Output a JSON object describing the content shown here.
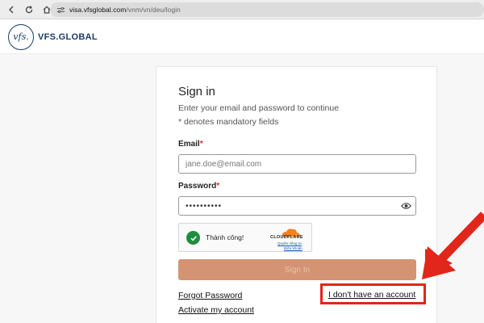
{
  "browser": {
    "url_host": "visa.vfsglobal.com",
    "url_path": "/vnm/vn/deu/login"
  },
  "site": {
    "logo_mark": "vfs.",
    "logo_text": "VFS.GLOBAL"
  },
  "login": {
    "title": "Sign in",
    "subtitle": "Enter your email and password to continue",
    "mandatory_note": "* denotes mandatory fields",
    "email_label": "Email",
    "email_placeholder": "jane.doe@email.com",
    "password_label": "Password",
    "password_value": "••••••••••",
    "required_mark": "*",
    "signin_label": "Sign In",
    "forgot_label": "Forgot Password",
    "activate_label": "Activate my account",
    "no_account_label": "I don't have an account"
  },
  "captcha": {
    "status": "Thành công!",
    "brand": "CLOUDFLARE",
    "privacy": "Quyền riêng tư",
    "terms": "Điều khoản"
  },
  "colors": {
    "brand_navy": "#1c3a63",
    "signin_button": "#d49373",
    "annotation_red": "#e1261c",
    "captcha_success": "#1e8e3e"
  }
}
